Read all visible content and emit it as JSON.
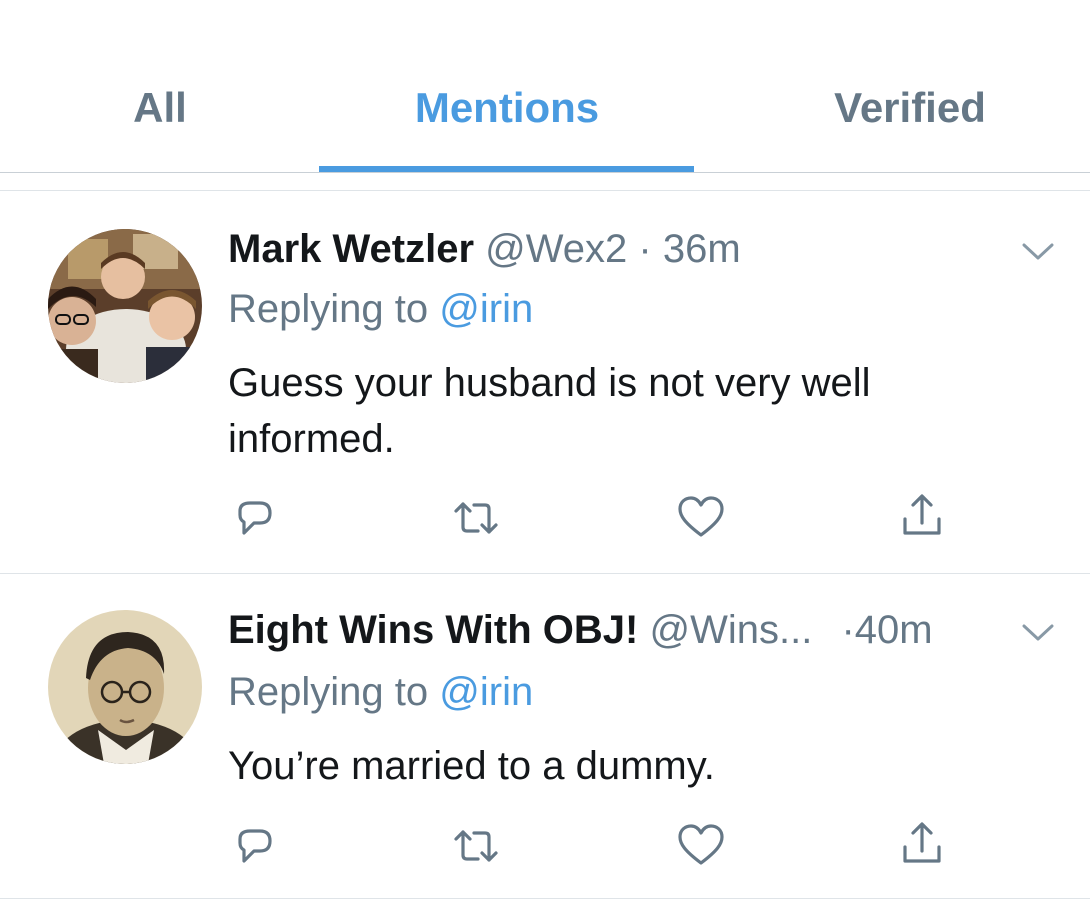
{
  "tabs": {
    "all": "All",
    "mentions": "Mentions",
    "verified": "Verified",
    "active": "Mentions"
  },
  "tweets": [
    {
      "name": "Mark Wetzler",
      "handle": "@Wex2",
      "separator": "·",
      "time": "36m",
      "replying_prefix": "Replying to",
      "replying_to": "@irin",
      "text": "Guess your husband is not very well informed.",
      "avatar_icon": "group-photo-avatar"
    },
    {
      "name": "Eight Wins With OBJ!",
      "handle": "@Wins...",
      "separator": "·",
      "time": "40m",
      "replying_prefix": "Replying to",
      "replying_to": "@irin",
      "text": "You’re married to a dummy.",
      "avatar_icon": "vintage-portrait-avatar"
    }
  ],
  "icons": {
    "reply": "reply-icon",
    "retweet": "retweet-icon",
    "like": "heart-icon",
    "share": "share-icon",
    "more": "chevron-down-icon"
  },
  "colors": {
    "accent": "#4a9be0",
    "secondary_text": "#657786",
    "primary_text": "#14171a",
    "divider": "#dfe4e8"
  }
}
